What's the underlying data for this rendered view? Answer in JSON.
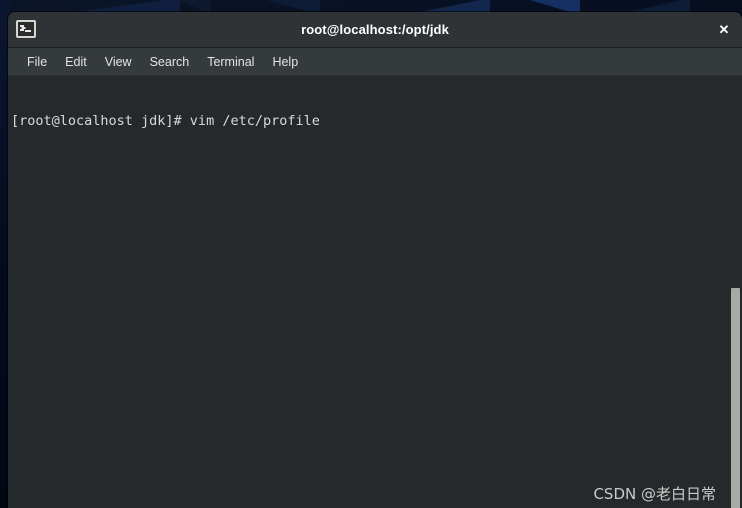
{
  "window": {
    "title": "root@localhost:/opt/jdk",
    "app_icon_name": "terminal-icon",
    "close_label": "✕",
    "colors": {
      "titlebar_bg": "#2f3336",
      "menubar_bg": "#353a3d",
      "terminal_bg": "#25292b",
      "terminal_fg": "#d8dad7",
      "scrollbar_thumb": "#a9aaa6",
      "desktop_bg": "#0b1528"
    }
  },
  "menu": {
    "items": [
      {
        "label": "File"
      },
      {
        "label": "Edit"
      },
      {
        "label": "View"
      },
      {
        "label": "Search"
      },
      {
        "label": "Terminal"
      },
      {
        "label": "Help"
      }
    ]
  },
  "terminal": {
    "lines": [
      "[root@localhost jdk]# vim /etc/profile"
    ],
    "prompt": "[root@localhost jdk]#",
    "command": "vim /etc/profile"
  },
  "watermark": {
    "text": "CSDN @老白日常"
  }
}
